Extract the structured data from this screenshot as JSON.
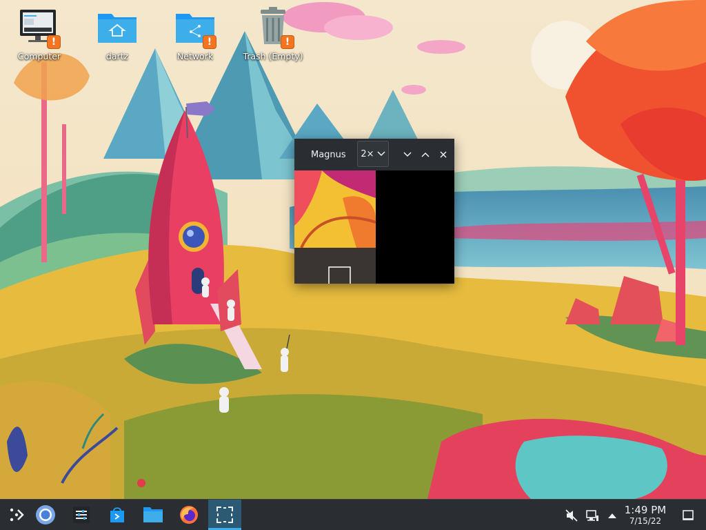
{
  "desktop": {
    "icons": [
      {
        "label": "Computer",
        "icon": "computer-icon",
        "warning": true
      },
      {
        "label": "dartz",
        "icon": "home-folder-icon",
        "warning": false
      },
      {
        "label": "Network",
        "icon": "network-folder-icon",
        "warning": true
      },
      {
        "label": "Trash (Empty)",
        "icon": "trash-icon",
        "warning": true
      }
    ],
    "warning_glyph": "!"
  },
  "magnifier": {
    "title": "Magnus",
    "zoom": "2×",
    "buttons": [
      "chevron-down-icon",
      "chevron-up-icon",
      "close-icon"
    ]
  },
  "taskbar": {
    "launchers": [
      "application-launcher-icon",
      "chromium-icon",
      "system-settings-icon",
      "discover-store-icon",
      "dolphin-file-manager-icon",
      "firefox-icon",
      "spectacle-screenshot-icon"
    ],
    "tray": [
      "volume-muted-icon",
      "network-wired-icon",
      "show-hidden-icons-icon",
      "show-desktop-icon"
    ],
    "clock": {
      "time": "1:49 PM",
      "date": "7/15/22"
    }
  },
  "colors": {
    "panel": "#2a2e32",
    "accent": "#3daee9",
    "warning": "#f47521",
    "folder": "#3daee9"
  }
}
